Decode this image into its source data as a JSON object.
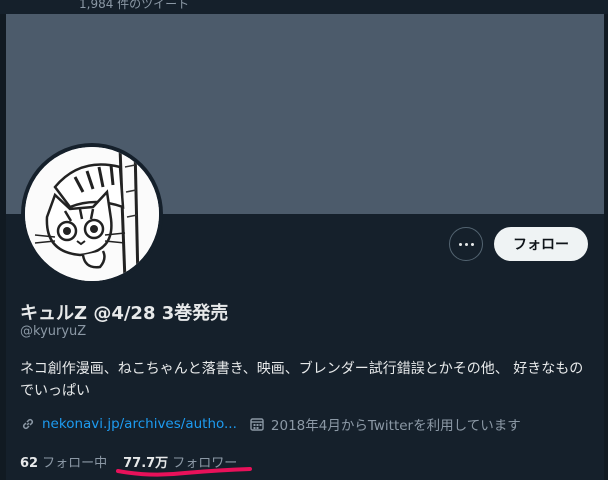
{
  "header": {
    "tweet_count": "1,984 件のツイート"
  },
  "profile": {
    "name": "キュルZ @4/28 3巻発売",
    "handle": "@kyuryuZ",
    "bio": "ネコ創作漫画、ねこちゃんと落書き、映画、ブレンダー試行錯誤とかその他、 好きなものでいっぱい",
    "link": "nekonavi.jp/archives/autho...",
    "joined": "2018年4月からTwitterを利用しています"
  },
  "actions": {
    "follow_label": "フォロー",
    "more_icon": "more-dots-icon"
  },
  "stats": {
    "following_count": "62",
    "following_label": "フォロー中",
    "followers_count": "77.7万",
    "followers_label": "フォロワー"
  },
  "colors": {
    "background": "#15202b",
    "banner": "#4c5b6b",
    "link": "#1d9bf0",
    "secondary_text": "#8b98a5",
    "annotation": "#e8115a"
  }
}
